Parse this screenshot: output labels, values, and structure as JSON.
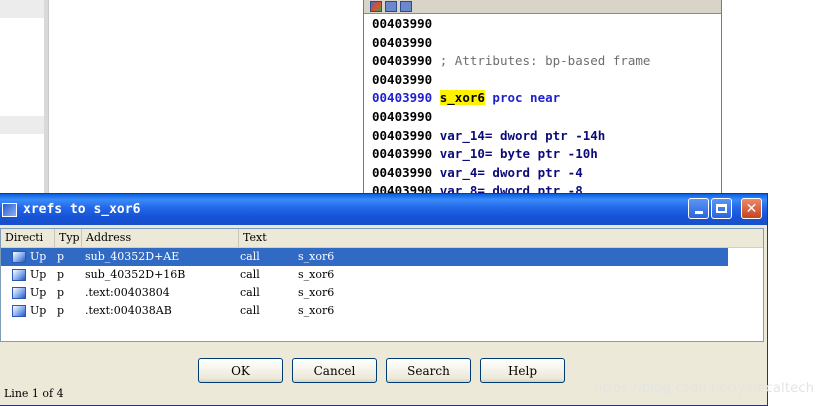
{
  "code_window": {
    "lines": [
      {
        "addr": "00403990",
        "rest": ""
      },
      {
        "addr": "00403990",
        "rest": ""
      },
      {
        "addr": "00403990",
        "comment": " ; Attributes: bp-based frame"
      },
      {
        "addr": "00403990",
        "rest": ""
      },
      {
        "addr": "00403990",
        "name": "s_xor6",
        "proc": " proc near",
        "highlight": true
      },
      {
        "addr": "00403990",
        "rest": ""
      },
      {
        "addr": "00403990",
        "var": " var_14= dword ptr -14h"
      },
      {
        "addr": "00403990",
        "var": " var_10= byte ptr -10h"
      },
      {
        "addr": "00403990",
        "var": " var_4= dword ptr -4"
      },
      {
        "addr": "00403990",
        "var": " var_8= dword ptr -8"
      }
    ]
  },
  "dialog": {
    "title": "xrefs to s_xor6",
    "columns": [
      "Directi",
      "Typ",
      "Address",
      "Text"
    ],
    "rows": [
      {
        "direction": "Up",
        "type": "p",
        "address": "sub_40352D+AE",
        "text1": "call",
        "text2": "s_xor6",
        "selected": true
      },
      {
        "direction": "Up",
        "type": "p",
        "address": "sub_40352D+16B",
        "text1": "call",
        "text2": "s_xor6",
        "selected": false
      },
      {
        "direction": "Up",
        "type": "p",
        "address": ".text:00403804",
        "text1": "call",
        "text2": "s_xor6",
        "selected": false
      },
      {
        "direction": "Up",
        "type": "p",
        "address": ".text:004038AB",
        "text1": "call",
        "text2": "s_xor6",
        "selected": false
      }
    ],
    "buttons": {
      "ok": "OK",
      "cancel": "Cancel",
      "search": "Search",
      "help": "Help"
    },
    "status": "Line 1 of 4"
  },
  "watermark": "https://blog.csdn.net/yalecaltech",
  "colors": {
    "title_bar": "#2367e8",
    "selection": "#316ac5",
    "dialog_bg": "#ece9d8",
    "highlight": "#fff200"
  }
}
